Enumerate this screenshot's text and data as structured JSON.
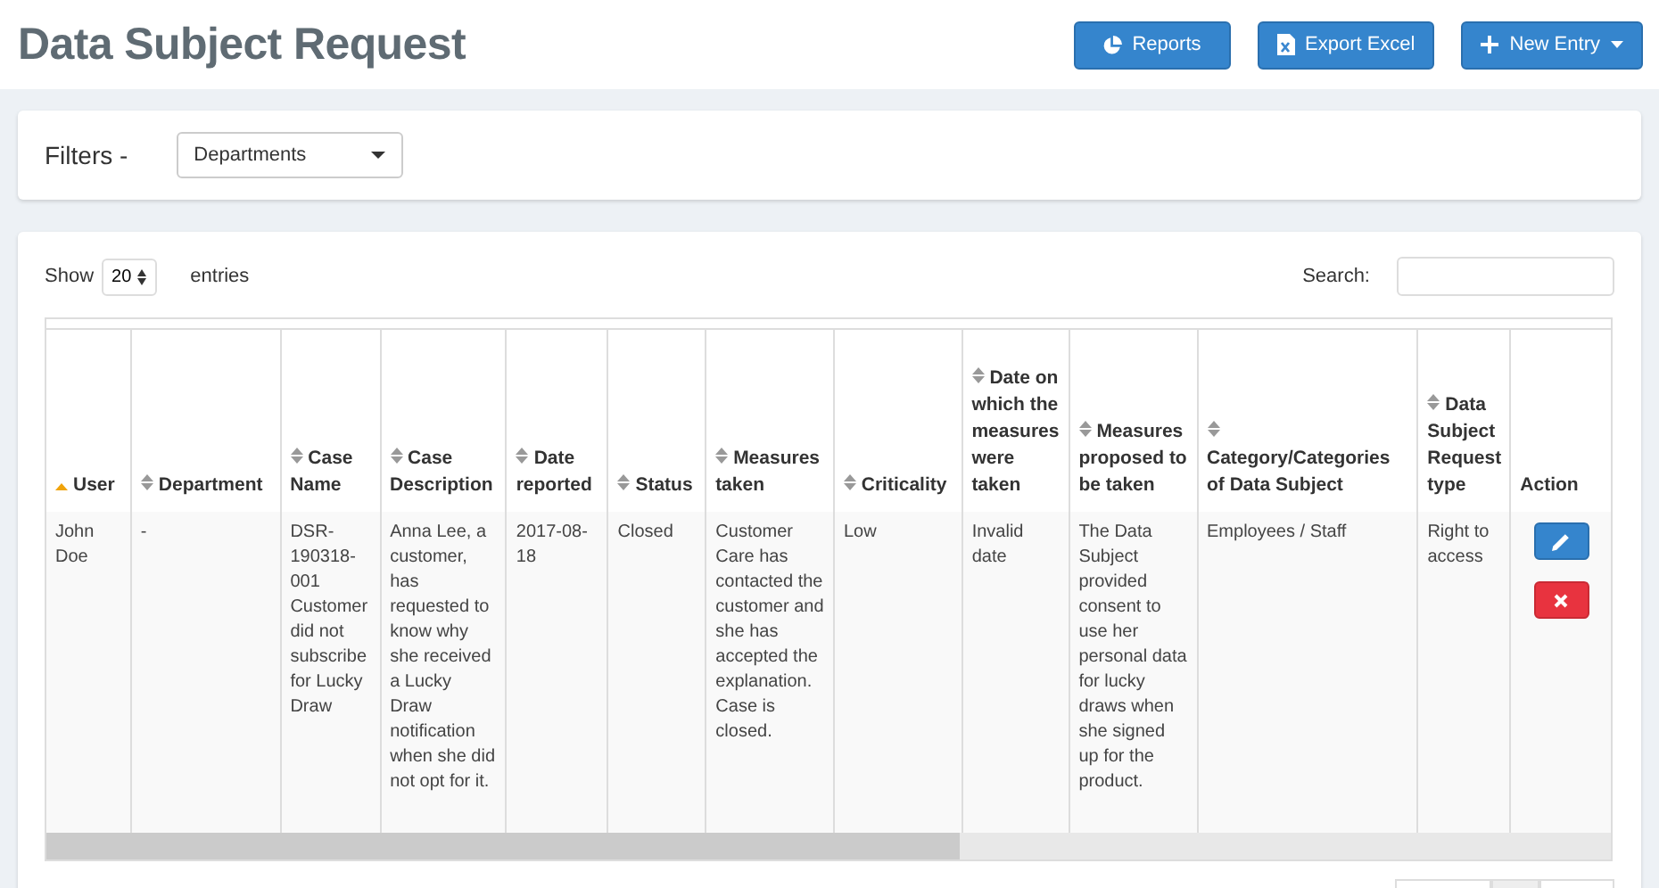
{
  "header": {
    "title": "Data Subject Request",
    "buttons": [
      {
        "label": "Reports",
        "kind": "chart",
        "dropdown": false
      },
      {
        "label": "Export Excel",
        "kind": "export",
        "dropdown": false
      },
      {
        "label": "New Entry",
        "kind": "add",
        "dropdown": true
      }
    ]
  },
  "filters": {
    "label": "Filters -",
    "dropdown": "Departments"
  },
  "table_controls": {
    "show_label": "Show",
    "page_size": "20",
    "entries_label": "entries",
    "search_label": "Search:"
  },
  "table": {
    "columns": [
      {
        "label": "User",
        "sorted": true
      },
      {
        "label": "Department",
        "sorted": false
      },
      {
        "label": "Case Name",
        "sorted": false
      },
      {
        "label": "Case Description",
        "sorted": false
      },
      {
        "label": "Date reported",
        "sorted": false
      },
      {
        "label": "Status",
        "sorted": false
      },
      {
        "label": "Measures taken",
        "sorted": false
      },
      {
        "label": "Criticality",
        "sorted": false
      },
      {
        "label": "Date on which the measures were taken",
        "sorted": false
      },
      {
        "label": "Measures proposed to be taken",
        "sorted": false
      },
      {
        "label": "Category/Categories of Data Subject",
        "sorted": false
      },
      {
        "label": "Data Subject Request type",
        "sorted": false
      }
    ],
    "action_column": "Action",
    "rows": [
      {
        "cells": [
          "John Doe",
          "-",
          "DSR-190318-001 Customer did not subscribe for Lucky Draw",
          "Anna Lee, a customer, has requested to know why she received a Lucky Draw notification when she did not opt for it.",
          "2017-08-18",
          "Closed",
          "Customer Care has contacted the customer and she has accepted the explanation. Case is closed.",
          "Low",
          "Invalid date",
          "The Data Subject provided consent to use her personal data for lucky draws when she signed up for the product.",
          "Employees / Staff",
          "Right to access"
        ],
        "actions": [
          {
            "kind": "edit"
          },
          {
            "kind": "delete"
          }
        ]
      }
    ]
  }
}
